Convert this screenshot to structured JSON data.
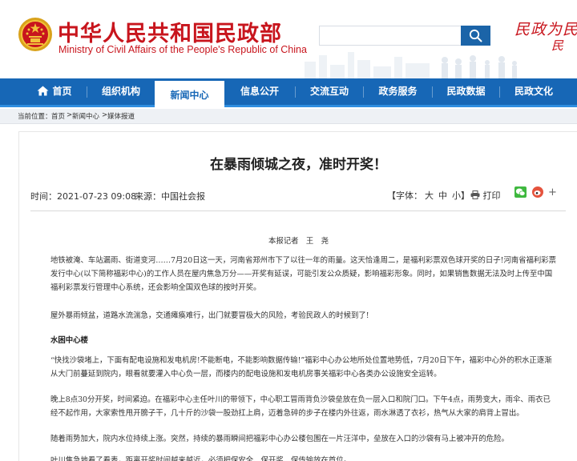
{
  "header": {
    "title_cn": "中华人民共和国民政部",
    "title_en": "Ministry of Civil Affairs of the People's Republic of China",
    "slogan": "民政为民",
    "slogan2": "民",
    "search_placeholder": "",
    "search_icon": "search-icon",
    "emblem_icon": "national-emblem-icon"
  },
  "nav": {
    "items": [
      {
        "label": "首页",
        "icon": "home-icon"
      },
      {
        "label": "组织机构"
      },
      {
        "label": "新闻中心"
      },
      {
        "label": "信息公开"
      },
      {
        "label": "交流互动"
      },
      {
        "label": "政务服务"
      },
      {
        "label": "民政数据"
      },
      {
        "label": "民政文化"
      }
    ],
    "active_index": 2
  },
  "breadcrumb": {
    "prefix": "当前位置：",
    "items": [
      "首页",
      "新闻中心",
      "媒体报道"
    ],
    "sep": ">"
  },
  "article": {
    "title": "在暴雨倾城之夜，准时开奖！",
    "date_label": "时间：",
    "date": "2021-07-23 09:08",
    "source_label": "来源：",
    "source": "中国社会报",
    "font_label": "【字体：",
    "font_large": "大",
    "font_medium": "中",
    "font_small": "小】",
    "print_label": "打印",
    "share_plus": "+",
    "byline": "本报记者　王　尧",
    "paragraphs": [
      "地铁被淹、车站漏雨、街道变河……7月20日这一天，河南省郑州市下了以往一年的雨量。这天恰逢周二，是福利彩票双色球开奖的日子!河南省福利彩票发行中心(以下简称福彩中心)的工作人员在屋内焦急万分——开奖有延误，可能引发公众质疑，影响福彩形象。同时，如果销售数据无法及时上传至中国福利彩票发行管理中心系统，还会影响全国双色球的按时开奖。",
      "屋外暴雨倾盆，道路水流湍急，交通瘫痪难行，出门就要冒极大的风险，考验民政人的时候到了!",
      "“快找沙袋堵上，下面有配电设施和发电机房!不能断电，不能影响数据传输!”福彩中心办公地所处位置地势低，7月20日下午，福彩中心外的积水正逐渐从大门前蔓延到院内，眼看就要灌入中心负一层，而楼内的配电设施和发电机房事关福彩中心各类办公设施安全运转。",
      "晚上8点30分开奖，时间紧迫。在福彩中心主任叶川的带领下，中心职工冒雨背负沙袋垒放在负一层入口和院门口。下午4点，雨势变大，雨伞、雨衣已经不起作用，大家索性甩开膀子干，几十斤的沙袋一股劲扛上肩，迈着急碎的步子在楼内外往返，雨水淋透了衣衫，热气从大家的肩背上冒出。",
      "随着雨势加大，院内水位持续上涨。突然，持续的暴雨瞬间把福彩中心办公楼包围在一片汪洋中，垒放在入口的沙袋有马上被冲开的危险。",
      "叶川焦急地看了看表，距离开奖时间越来越近，必须把保安全、保开奖、保传输放在首位。"
    ],
    "subhead": "水困中心楼"
  },
  "colors": {
    "brand_red": "#c8151d",
    "nav_blue": "#1767b6",
    "search_blue": "#1b64a8"
  }
}
